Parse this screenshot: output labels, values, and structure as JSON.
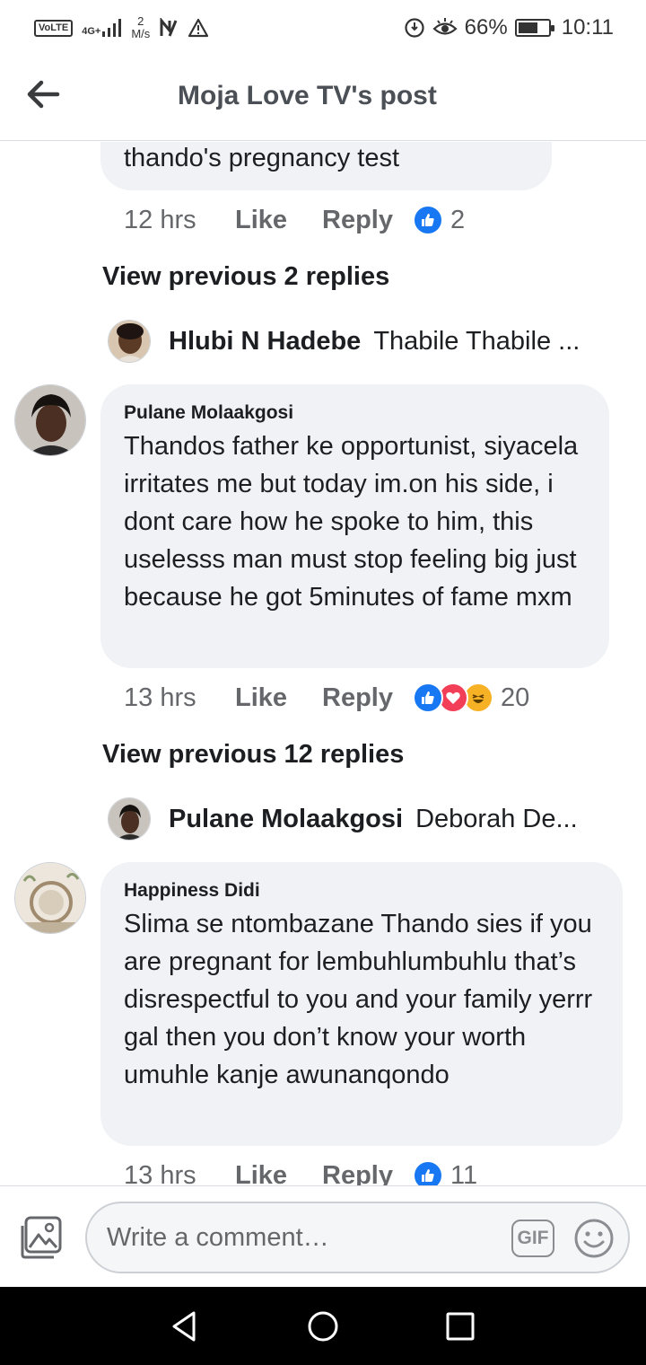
{
  "status_bar": {
    "volte": "VoLTE",
    "network": "4G+",
    "speed_value": "2",
    "speed_unit": "M/s",
    "battery": "66%",
    "battery_level": 0.66,
    "time": "10:11"
  },
  "header": {
    "title": "Moja Love TV's post"
  },
  "comments": [
    {
      "text": "thando's pregnancy test",
      "time": "12 hrs",
      "like_label": "Like",
      "reply_label": "Reply",
      "reactions": [
        "like"
      ],
      "reaction_count": "2"
    },
    {
      "author": "Pulane Molaakgosi",
      "text": "Thandos father ke opportunist, siyacela irritates me but today im.on his side, i dont care how he spoke to him, this uselesss man must stop feeling big just because he got 5minutes of fame mxm",
      "time": "13 hrs",
      "like_label": "Like",
      "reply_label": "Reply",
      "reactions": [
        "like",
        "love",
        "haha"
      ],
      "reaction_count": "20"
    },
    {
      "author": "Happiness Didi",
      "text": "Slima se ntombazane Thando sies if you are pregnant for lembuhlumbuhlu that’s disrespectful to you and your family yerrr gal then you don’t know your worth umuhle kanje awunanqondo",
      "time": "13 hrs",
      "like_label": "Like",
      "reply_label": "Reply",
      "reactions": [
        "like"
      ],
      "reaction_count": "11"
    }
  ],
  "threads": [
    {
      "view_previous": "View previous 2 replies",
      "reply_author": "Hlubi N Hadebe",
      "reply_snippet": "Thabile Thabile ..."
    },
    {
      "view_previous": "View previous 12 replies",
      "reply_author": "Pulane Molaakgosi",
      "reply_snippet": "Deborah De..."
    }
  ],
  "composer": {
    "placeholder": "Write a comment…",
    "gif_label": "GIF"
  },
  "colors": {
    "like_blue": "#1877f2",
    "love_red": "#f33e58",
    "haha_yellow": "#f7b125",
    "bubble_bg": "#f0f2f5",
    "meta_gray": "#65676b"
  },
  "icons": {
    "back": "back-arrow-icon",
    "photo": "photo-icon",
    "emoji": "emoji-icon",
    "nav": [
      "nav-back-icon",
      "nav-home-icon",
      "nav-recents-icon"
    ]
  }
}
